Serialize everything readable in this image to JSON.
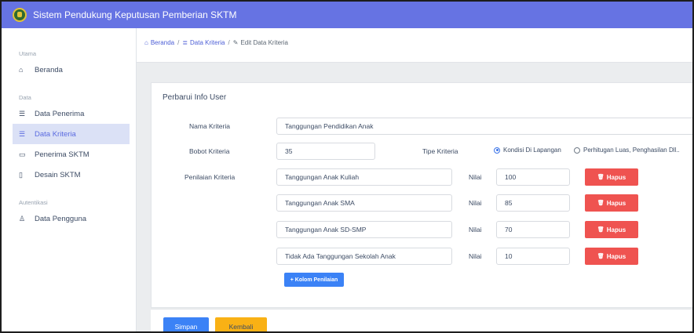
{
  "app": {
    "title": "Sistem Pendukung Keputusan Pemberian SKTM"
  },
  "sidebar": {
    "sections": [
      {
        "label": "Utama",
        "items": [
          {
            "label": "Beranda",
            "icon": "home-icon"
          }
        ]
      },
      {
        "label": "Data",
        "items": [
          {
            "label": "Data Penerima",
            "icon": "list-icon"
          },
          {
            "label": "Data Kriteria",
            "icon": "list-icon",
            "active": true
          },
          {
            "label": "Penerima SKTM",
            "icon": "calendar-icon"
          },
          {
            "label": "Desain SKTM",
            "icon": "file-icon"
          }
        ]
      },
      {
        "label": "Autentikasi",
        "items": [
          {
            "label": "Data Pengguna",
            "icon": "user-icon"
          }
        ]
      }
    ]
  },
  "breadcrumb": {
    "home": "Beranda",
    "sep": "/",
    "data": "Data Kriteria",
    "current": "Edit Data Kriteria"
  },
  "form": {
    "title": "Perbarui Info User",
    "nama_label": "Nama Kriteria",
    "nama_value": "Tanggungan Pendidikan Anak",
    "bobot_label": "Bobot Kriteria",
    "bobot_value": "35",
    "tipe_label": "Tipe Kriteria",
    "tipe_options": [
      {
        "label": "Kondisi Di Lapangan",
        "selected": true
      },
      {
        "label": "Perhitugan Luas, Penghasilan Dll..",
        "selected": false
      }
    ],
    "penilaian_label": "Penilaian Kriteria",
    "nilai_label": "Nilai",
    "hapus_label": "Hapus",
    "rows": [
      {
        "penilaian": "Tanggungan Anak Kuliah",
        "nilai": "100"
      },
      {
        "penilaian": "Tanggungan Anak SMA",
        "nilai": "85"
      },
      {
        "penilaian": "Tanggungan Anak SD-SMP",
        "nilai": "70"
      },
      {
        "penilaian": "Tidak Ada Tanggungan Sekolah Anak",
        "nilai": "10"
      }
    ],
    "add_label": "+ Kolom Penilaian"
  },
  "actions": {
    "save": "Simpan",
    "back": "Kembali"
  },
  "colors": {
    "topbar": "#6673e3",
    "active_nav": "#dbe1f6",
    "primary": "#3b82f6",
    "danger": "#ef5350",
    "warning": "#f9b115"
  }
}
